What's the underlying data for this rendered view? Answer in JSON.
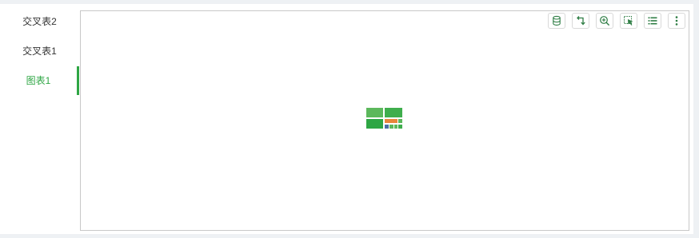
{
  "tabs": [
    {
      "label": "交叉表2",
      "active": false
    },
    {
      "label": "交叉表1",
      "active": false
    },
    {
      "label": "图表1",
      "active": true
    }
  ],
  "toolbar": {
    "buttons": [
      {
        "icon": "database-icon"
      },
      {
        "icon": "rotate-arrow-icon"
      },
      {
        "icon": "zoom-in-icon"
      },
      {
        "icon": "select-cursor-icon"
      },
      {
        "icon": "list-icon"
      },
      {
        "icon": "more-vertical-icon"
      }
    ]
  },
  "placeholder": {
    "icon": "treemap-placeholder-icon"
  },
  "colors": {
    "accent": "#2ea644",
    "icon": "#2e7d44",
    "treemap_light": "#5cb85c",
    "treemap_dark": "#2ea644",
    "treemap_orange": "#e8853b",
    "treemap_blue": "#4a6fa5"
  }
}
